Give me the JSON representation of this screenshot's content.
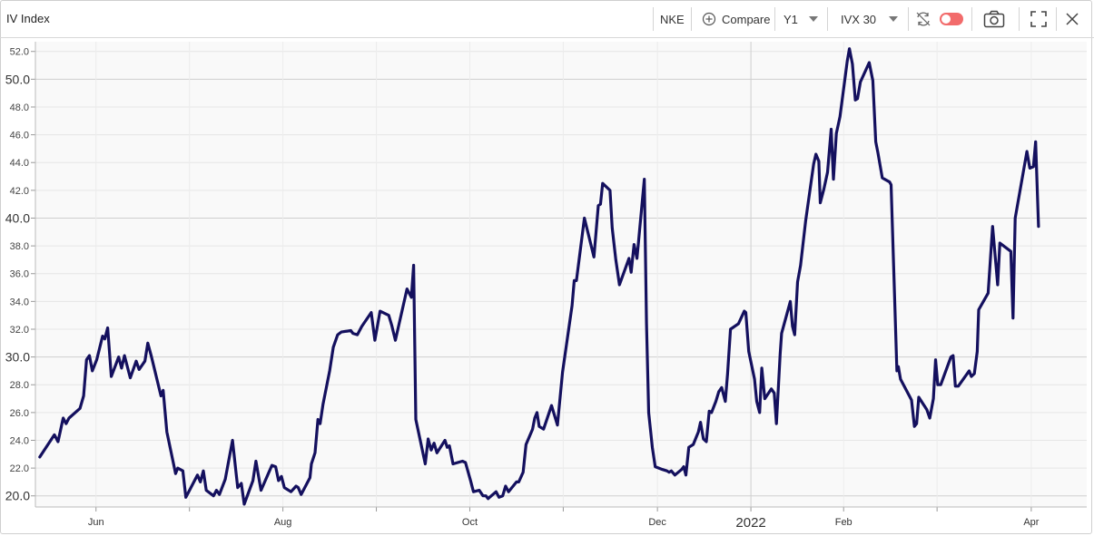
{
  "header": {
    "title": "IV Index",
    "symbol": "NKE",
    "compare_label": "Compare",
    "period": "Y1",
    "metric": "IVX 30"
  },
  "icons": {
    "compare": "plus-circle-icon",
    "period_dropdown": "chevron-down-icon",
    "metric_dropdown": "chevron-down-icon",
    "sync": "sync-icon",
    "toggle": "toggle-switch-icon",
    "camera": "camera-icon",
    "fullscreen": "fullscreen-icon",
    "close": "close-icon"
  },
  "colors": {
    "line": "#14105e",
    "toggle": "#f26b6b",
    "plot_bg": "#f9f9f9",
    "grid": "#d8d8d8"
  },
  "chart_data": {
    "type": "line",
    "title": "IV Index",
    "series": [
      {
        "name": "IVX 30",
        "points": [
          [
            0.0,
            22.8
          ],
          [
            2.0,
            24.4
          ],
          [
            2.5,
            23.9
          ],
          [
            3.2,
            25.6
          ],
          [
            3.6,
            25.2
          ],
          [
            4.0,
            25.6
          ],
          [
            5.5,
            26.3
          ],
          [
            6.0,
            27.2
          ],
          [
            6.4,
            29.8
          ],
          [
            6.8,
            30.1
          ],
          [
            7.2,
            29.0
          ],
          [
            7.8,
            29.8
          ],
          [
            8.6,
            31.5
          ],
          [
            8.9,
            31.3
          ],
          [
            9.3,
            32.1
          ],
          [
            9.8,
            28.6
          ],
          [
            10.3,
            29.3
          ],
          [
            10.8,
            30.0
          ],
          [
            11.2,
            29.2
          ],
          [
            11.6,
            30.1
          ],
          [
            12.4,
            28.5
          ],
          [
            13.2,
            29.7
          ],
          [
            13.6,
            29.1
          ],
          [
            14.4,
            29.7
          ],
          [
            14.8,
            31.0
          ],
          [
            15.3,
            30.0
          ],
          [
            16.6,
            27.2
          ],
          [
            16.9,
            27.6
          ],
          [
            17.4,
            24.6
          ],
          [
            18.6,
            21.6
          ],
          [
            18.9,
            22.0
          ],
          [
            19.6,
            21.8
          ],
          [
            20.0,
            19.9
          ],
          [
            20.4,
            20.3
          ],
          [
            21.6,
            21.5
          ],
          [
            22.0,
            21.0
          ],
          [
            22.4,
            21.8
          ],
          [
            22.8,
            20.4
          ],
          [
            23.8,
            20.0
          ],
          [
            24.2,
            20.4
          ],
          [
            24.6,
            20.1
          ],
          [
            25.4,
            21.2
          ],
          [
            26.4,
            24.0
          ],
          [
            27.1,
            20.6
          ],
          [
            27.6,
            20.9
          ],
          [
            28.0,
            19.4
          ],
          [
            29.2,
            21.1
          ],
          [
            29.6,
            22.5
          ],
          [
            30.3,
            20.4
          ],
          [
            31.8,
            22.2
          ],
          [
            32.3,
            22.1
          ],
          [
            32.7,
            21.1
          ],
          [
            33.1,
            21.4
          ],
          [
            33.5,
            20.6
          ],
          [
            34.4,
            20.3
          ],
          [
            35.1,
            20.7
          ],
          [
            35.4,
            20.6
          ],
          [
            35.8,
            20.1
          ],
          [
            37.0,
            21.3
          ],
          [
            37.2,
            22.3
          ],
          [
            37.7,
            23.1
          ],
          [
            38.1,
            25.5
          ],
          [
            38.4,
            25.2
          ],
          [
            38.8,
            26.6
          ],
          [
            39.7,
            29.0
          ],
          [
            40.2,
            30.7
          ],
          [
            40.8,
            31.6
          ],
          [
            41.3,
            31.8
          ],
          [
            42.6,
            31.9
          ],
          [
            42.9,
            31.7
          ],
          [
            43.5,
            31.6
          ],
          [
            44.1,
            32.2
          ],
          [
            45.4,
            33.2
          ],
          [
            45.9,
            31.2
          ],
          [
            46.6,
            33.3
          ],
          [
            47.8,
            33.0
          ],
          [
            48.2,
            32.3
          ],
          [
            48.7,
            31.2
          ],
          [
            50.3,
            34.9
          ],
          [
            50.9,
            34.3
          ],
          [
            51.2,
            36.6
          ],
          [
            51.5,
            25.5
          ],
          [
            52.8,
            22.3
          ],
          [
            53.2,
            24.1
          ],
          [
            53.6,
            23.3
          ],
          [
            54.0,
            23.8
          ],
          [
            54.4,
            23.1
          ],
          [
            55.5,
            24.0
          ],
          [
            55.8,
            23.5
          ],
          [
            56.1,
            23.6
          ],
          [
            56.6,
            22.3
          ],
          [
            57.9,
            22.5
          ],
          [
            58.3,
            22.4
          ],
          [
            59.0,
            21.1
          ],
          [
            59.4,
            20.3
          ],
          [
            60.2,
            20.4
          ],
          [
            60.7,
            20.0
          ],
          [
            61.1,
            20.0
          ],
          [
            61.4,
            19.8
          ],
          [
            62.5,
            20.3
          ],
          [
            62.9,
            19.9
          ],
          [
            63.4,
            20.0
          ],
          [
            63.8,
            20.7
          ],
          [
            64.2,
            20.3
          ],
          [
            65.3,
            21.0
          ],
          [
            65.6,
            21.0
          ],
          [
            66.2,
            21.7
          ],
          [
            66.6,
            23.7
          ],
          [
            67.5,
            24.8
          ],
          [
            67.8,
            25.6
          ],
          [
            68.1,
            26.0
          ],
          [
            68.4,
            25.0
          ],
          [
            69.0,
            24.8
          ],
          [
            70.1,
            26.5
          ],
          [
            70.9,
            25.1
          ],
          [
            71.6,
            28.9
          ],
          [
            72.9,
            33.7
          ],
          [
            73.2,
            35.5
          ],
          [
            73.5,
            35.5
          ],
          [
            74.6,
            40.0
          ],
          [
            75.9,
            37.2
          ],
          [
            76.5,
            40.9
          ],
          [
            76.8,
            41.0
          ],
          [
            77.1,
            42.5
          ],
          [
            78.1,
            42.0
          ],
          [
            78.4,
            39.3
          ],
          [
            78.9,
            37.0
          ],
          [
            79.4,
            35.2
          ],
          [
            80.7,
            37.1
          ],
          [
            81.0,
            36.1
          ],
          [
            81.4,
            38.1
          ],
          [
            81.8,
            37.1
          ],
          [
            82.8,
            42.8
          ],
          [
            83.1,
            32.4
          ],
          [
            83.4,
            26.0
          ],
          [
            83.9,
            23.5
          ],
          [
            84.3,
            22.1
          ],
          [
            85.3,
            21.9
          ],
          [
            85.9,
            21.8
          ],
          [
            86.2,
            21.7
          ],
          [
            86.5,
            21.8
          ],
          [
            87.0,
            21.5
          ],
          [
            87.9,
            21.9
          ],
          [
            88.2,
            22.1
          ],
          [
            88.5,
            21.5
          ],
          [
            88.9,
            23.5
          ],
          [
            89.5,
            23.7
          ],
          [
            90.2,
            24.6
          ],
          [
            90.5,
            25.3
          ],
          [
            90.9,
            24.1
          ],
          [
            91.3,
            23.9
          ],
          [
            91.7,
            26.1
          ],
          [
            92.0,
            26.0
          ],
          [
            92.6,
            26.8
          ],
          [
            93.0,
            27.5
          ],
          [
            93.4,
            27.8
          ],
          [
            93.9,
            26.8
          ],
          [
            94.2,
            28.8
          ],
          [
            94.6,
            32.0
          ],
          [
            95.7,
            32.4
          ],
          [
            96.5,
            33.3
          ],
          [
            96.7,
            33.2
          ],
          [
            97.1,
            30.4
          ],
          [
            97.9,
            28.4
          ],
          [
            98.2,
            26.8
          ],
          [
            98.6,
            26.0
          ],
          [
            98.9,
            29.2
          ],
          [
            99.3,
            27.0
          ],
          [
            100.2,
            27.7
          ],
          [
            100.6,
            27.4
          ],
          [
            100.9,
            25.2
          ],
          [
            101.4,
            30.2
          ],
          [
            101.6,
            31.7
          ],
          [
            102.8,
            34.0
          ],
          [
            103.1,
            32.2
          ],
          [
            103.4,
            31.6
          ],
          [
            103.8,
            35.4
          ],
          [
            104.2,
            36.6
          ],
          [
            104.9,
            39.8
          ],
          [
            106.0,
            43.9
          ],
          [
            106.3,
            44.6
          ],
          [
            106.7,
            44.1
          ],
          [
            106.9,
            41.1
          ],
          [
            107.4,
            42.1
          ],
          [
            107.9,
            43.3
          ],
          [
            108.4,
            46.4
          ],
          [
            108.7,
            42.8
          ],
          [
            109.1,
            46.1
          ],
          [
            109.6,
            47.3
          ],
          [
            110.6,
            51.3
          ],
          [
            110.9,
            52.2
          ],
          [
            111.3,
            51.1
          ],
          [
            111.7,
            48.5
          ],
          [
            112.0,
            48.6
          ],
          [
            112.4,
            49.8
          ],
          [
            113.6,
            51.2
          ],
          [
            114.1,
            49.9
          ],
          [
            114.5,
            45.5
          ],
          [
            114.8,
            44.7
          ],
          [
            115.4,
            42.9
          ],
          [
            116.4,
            42.6
          ],
          [
            116.6,
            42.4
          ],
          [
            117.4,
            29.0
          ],
          [
            117.6,
            29.3
          ],
          [
            117.9,
            28.4
          ],
          [
            119.1,
            27.2
          ],
          [
            119.4,
            26.9
          ],
          [
            119.8,
            25.0
          ],
          [
            120.1,
            25.2
          ],
          [
            120.4,
            27.1
          ],
          [
            121.5,
            26.2
          ],
          [
            121.9,
            25.6
          ],
          [
            122.4,
            27.0
          ],
          [
            122.7,
            29.8
          ],
          [
            123.0,
            28.0
          ],
          [
            123.4,
            28.0
          ],
          [
            124.8,
            30.0
          ],
          [
            125.1,
            30.1
          ],
          [
            125.4,
            27.9
          ],
          [
            125.8,
            27.9
          ],
          [
            127.3,
            29.0
          ],
          [
            127.6,
            28.6
          ],
          [
            128.0,
            28.8
          ],
          [
            128.4,
            30.4
          ],
          [
            128.6,
            33.4
          ],
          [
            129.9,
            34.6
          ],
          [
            130.5,
            39.4
          ],
          [
            131.2,
            35.2
          ],
          [
            131.5,
            38.2
          ],
          [
            133.0,
            37.6
          ],
          [
            133.3,
            32.8
          ],
          [
            133.6,
            40.0
          ],
          [
            135.2,
            44.8
          ],
          [
            135.6,
            43.6
          ],
          [
            136.1,
            43.7
          ],
          [
            136.4,
            45.5
          ],
          [
            136.8,
            39.4
          ]
        ]
      }
    ],
    "x_ticks": [
      "Jun",
      "Aug",
      "Oct",
      "Dec",
      "2022",
      "Feb",
      "Apr"
    ],
    "x_tick_days": [
      7.7,
      33.3,
      58.9,
      84.6,
      97.4,
      110.1,
      135.8
    ],
    "x_minor_ticks": [
      20.5,
      46.1,
      71.7,
      122.9,
      148.6,
      161.4,
      174.1
    ],
    "yticks": [
      "20.0",
      "22.0",
      "24.0",
      "26.0",
      "28.0",
      "30.0",
      "32.0",
      "34.0",
      "36.0",
      "38.0",
      "40.0",
      "42.0",
      "44.0",
      "46.0",
      "48.0",
      "50.0",
      "52.0"
    ],
    "ylim": [
      19.2,
      52.7
    ],
    "grid": true
  }
}
